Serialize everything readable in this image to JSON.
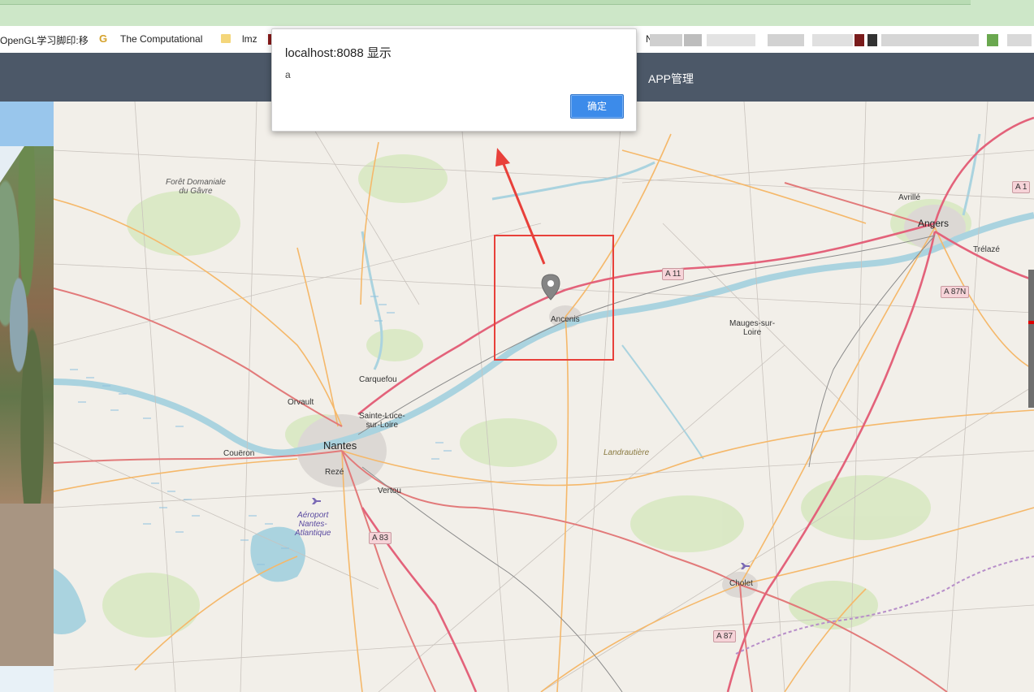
{
  "bookmarks": {
    "items": [
      {
        "label": "OpenGL学习脚印:移"
      },
      {
        "label": "The Computational"
      },
      {
        "label": "lmz"
      },
      {
        "label": "N"
      }
    ]
  },
  "app": {
    "nav_label": "APP管理"
  },
  "dialog": {
    "title": "localhost:8088 显示",
    "message": "a",
    "ok_label": "确定"
  },
  "map": {
    "labels": {
      "foret": [
        "Forêt Domaniale",
        "du Gâvre"
      ],
      "avrille": "Avrillé",
      "angers": "Angers",
      "trelaze": "Trélazé",
      "ancenis": "Ancenis",
      "mauges": [
        "Mauges-sur-",
        "Loire"
      ],
      "carquefou": "Carquefou",
      "orvault": "Orvault",
      "sainte_luce": [
        "Sainte-Luce-",
        "sur-Loire"
      ],
      "nantes": "Nantes",
      "coueron": "Couëron",
      "reze": "Rezé",
      "vertou": "Vertou",
      "landrautiere": "Landrautière",
      "aeroport": [
        "Aéroport",
        "Nantes-",
        "Atlantique"
      ],
      "cholet": "Cholet"
    },
    "road_shields": {
      "a11": "A 11",
      "a87n": "A 87N",
      "a83": "A 83",
      "a87": "A 87",
      "a11_edge": "A 1"
    }
  },
  "colors": {
    "header_bg": "#4c5868",
    "dialog_button": "#3c8bea",
    "highlight_box": "#e8403a",
    "arrow": "#e8403a"
  }
}
